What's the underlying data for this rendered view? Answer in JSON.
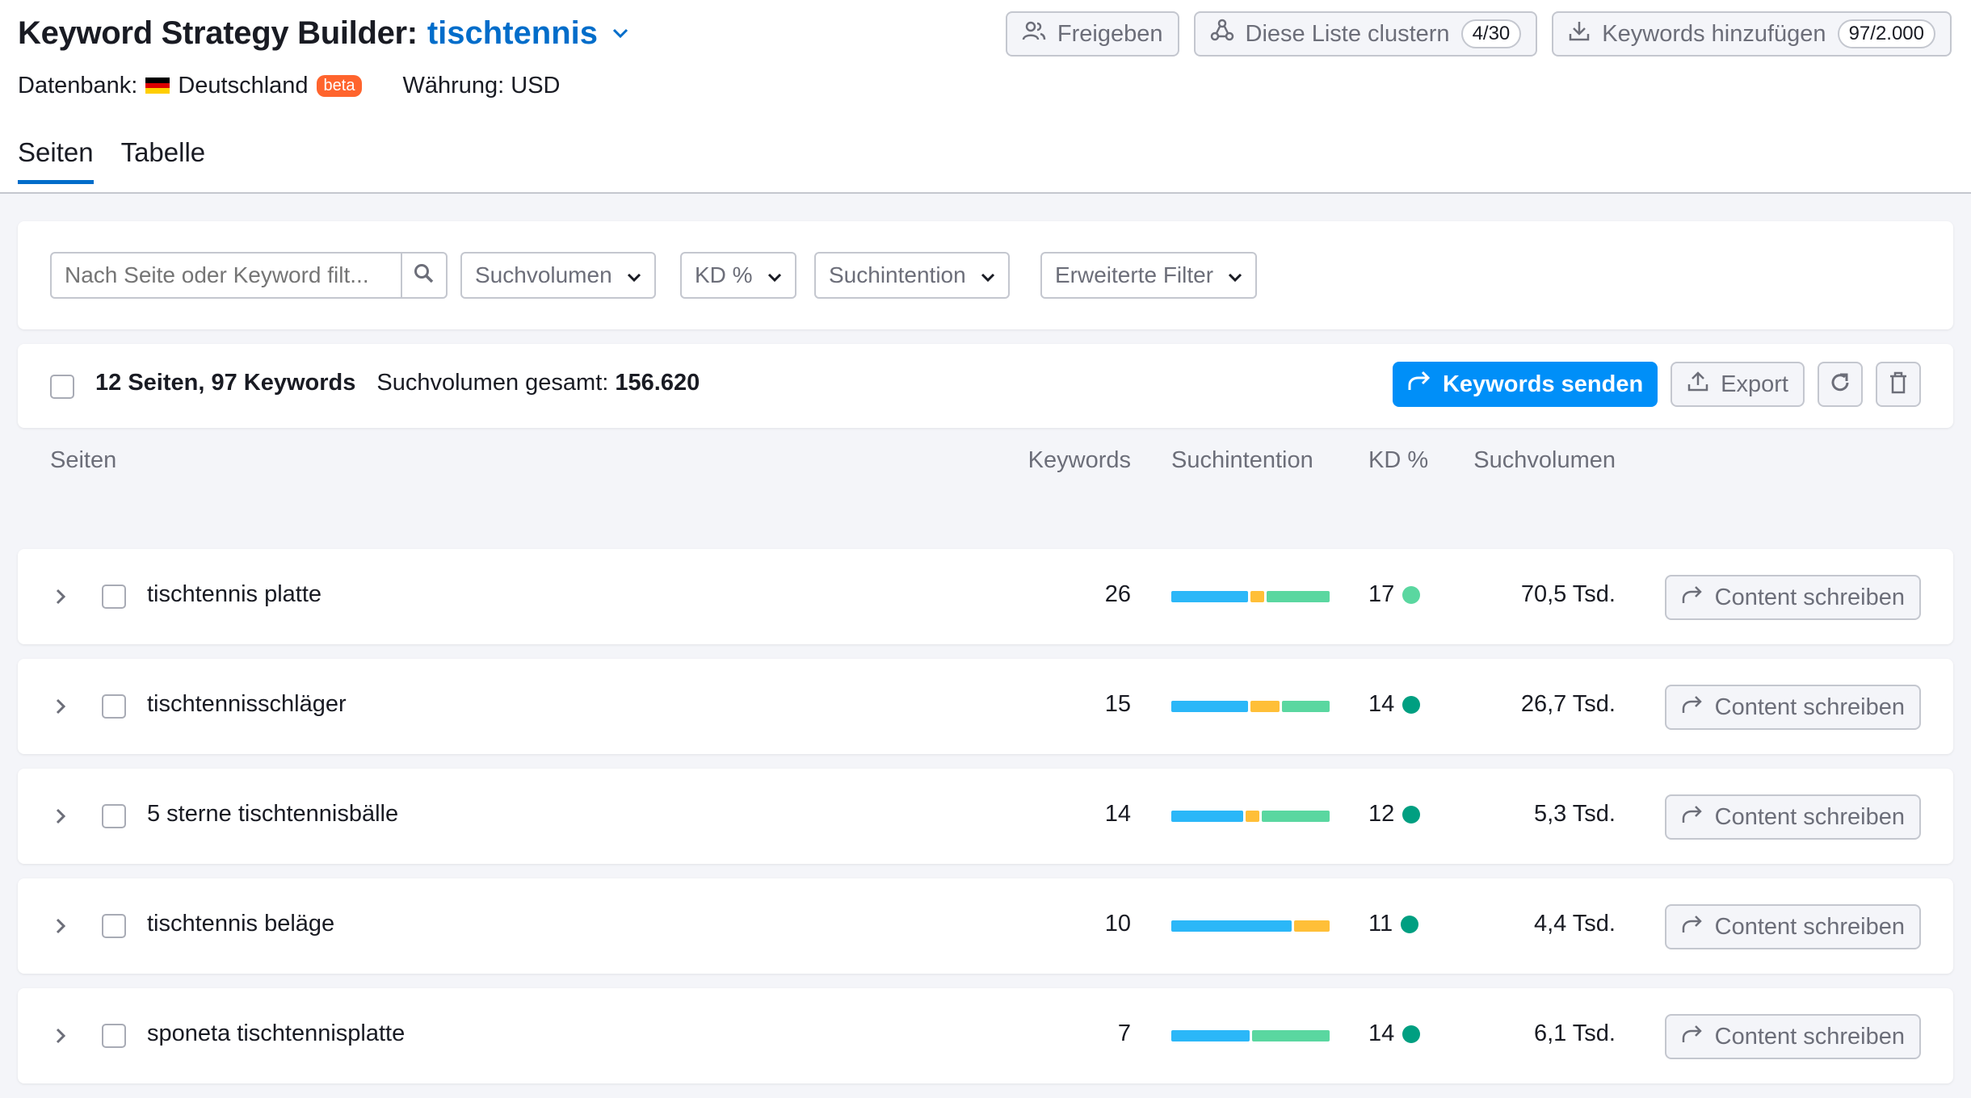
{
  "header": {
    "title": "Keyword Strategy Builder:",
    "project": "tischtennis",
    "database_label": "Datenbank:",
    "country": "Deutschland",
    "beta": "beta",
    "currency": "Währung: USD",
    "share_label": "Freigeben",
    "cluster_label": "Diese Liste clustern",
    "cluster_count": "4/30",
    "add_keywords_label": "Keywords hinzufügen",
    "add_keywords_count": "97/2.000"
  },
  "tabs": [
    {
      "label": "Seiten",
      "active": true
    },
    {
      "label": "Tabelle",
      "active": false
    }
  ],
  "filters": {
    "search_placeholder": "Nach Seite oder Keyword filt...",
    "volume": "Suchvolumen",
    "kd": "KD %",
    "intent": "Suchintention",
    "advanced": "Erweiterte Filter"
  },
  "summary": {
    "pages_keywords": "12 Seiten, 97 Keywords",
    "total_volume_label": "Suchvolumen gesamt:",
    "total_volume": "156.620",
    "send_keywords": "Keywords senden",
    "export": "Export"
  },
  "columns": {
    "pages": "Seiten",
    "keywords": "Keywords",
    "intent": "Suchintention",
    "kd": "KD %",
    "volume": "Suchvolumen"
  },
  "content_button_label": "Content schreiben",
  "colors": {
    "accent": "#006dca",
    "primary_button": "#008ff8",
    "intent_informational": "#2bb7f8",
    "intent_commercial": "#ffbf38",
    "intent_transactional": "#5ad7a0",
    "kd_very_easy": "#5ad7a0",
    "kd_easy": "#009f81"
  },
  "rows": [
    {
      "name": "tischtennis platte",
      "keywords": "26",
      "kd": "17",
      "kd_color": "#5ad7a0",
      "volume": "70,5 Tsd.",
      "intent": [
        0.5,
        0.09,
        0.41
      ]
    },
    {
      "name": "tischtennisschläger",
      "keywords": "15",
      "kd": "14",
      "kd_color": "#009f81",
      "volume": "26,7 Tsd.",
      "intent": [
        0.5,
        0.19,
        0.31
      ]
    },
    {
      "name": "5 sterne tischtennisbälle",
      "keywords": "14",
      "kd": "12",
      "kd_color": "#009f81",
      "volume": "5,3 Tsd.",
      "intent": [
        0.47,
        0.09,
        0.44
      ]
    },
    {
      "name": "tischtennis beläge",
      "keywords": "10",
      "kd": "11",
      "kd_color": "#009f81",
      "volume": "4,4 Tsd.",
      "intent": [
        0.77,
        0.23,
        0
      ]
    },
    {
      "name": "sponeta tischtennisplatte",
      "keywords": "7",
      "kd": "14",
      "kd_color": "#009f81",
      "volume": "6,1 Tsd.",
      "intent": [
        0.5,
        0,
        0.5
      ]
    }
  ]
}
